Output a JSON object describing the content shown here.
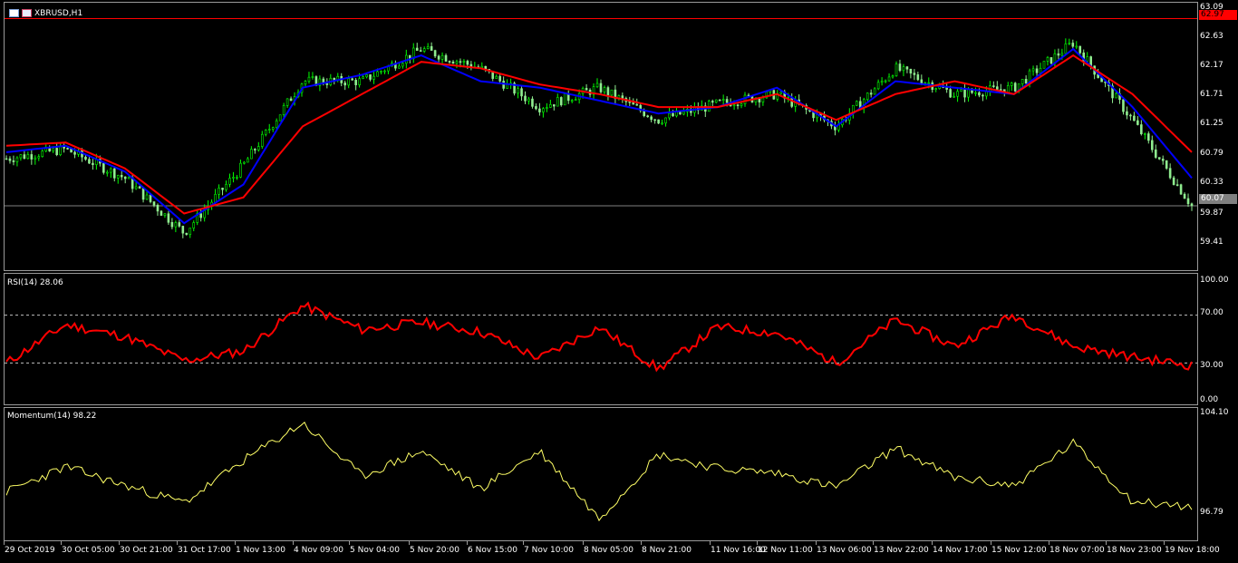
{
  "symbol_title": "XBRUSD,H1",
  "colors": {
    "background": "#000000",
    "bull_candle": "#00ff00",
    "candle": "#90ee90",
    "ma_fast": "#0000ff",
    "ma_slow": "#ff0000",
    "rsi_line": "#ff0000",
    "momentum_line": "#ffff66",
    "level_line": "#ff0000",
    "bid_line": "#808080",
    "grid": "#9a9a9a"
  },
  "price_axis": {
    "labels": [
      "63.09",
      "62.63",
      "62.17",
      "61.71",
      "61.25",
      "60.79",
      "60.33",
      "59.87",
      "59.41"
    ],
    "upper_tag": "62.97",
    "current_tag": "60.07"
  },
  "rsi": {
    "title": "RSI(14) 28.06",
    "axis_labels": [
      "100.00",
      "70.00",
      "30.00",
      "0.00"
    ],
    "levels": [
      70,
      30
    ]
  },
  "momentum": {
    "title": "Momentum(14) 98.22",
    "axis_labels": [
      "104.10",
      "96.79"
    ]
  },
  "time_axis": [
    "29 Oct 2019",
    "30 Oct 05:00",
    "30 Oct 21:00",
    "31 Oct 17:00",
    "1 Nov 13:00",
    "4 Nov 09:00",
    "5 Nov 04:00",
    "5 Nov 20:00",
    "6 Nov 15:00",
    "7 Nov 10:00",
    "8 Nov 05:00",
    "8 Nov 21:00",
    "11 Nov 16:00",
    "12 Nov 11:00",
    "13 Nov 06:00",
    "13 Nov 22:00",
    "14 Nov 17:00",
    "15 Nov 12:00",
    "18 Nov 07:00",
    "18 Nov 23:00",
    "19 Nov 18:00"
  ],
  "chart_data": [
    {
      "type": "line",
      "title": "XBRUSD,H1",
      "ylim": [
        59.1,
        63.09
      ],
      "x": [
        "29 Oct 2019",
        "30 Oct 05:00",
        "30 Oct 21:00",
        "31 Oct 17:00",
        "1 Nov 13:00",
        "4 Nov 09:00",
        "5 Nov 04:00",
        "5 Nov 20:00",
        "6 Nov 15:00",
        "7 Nov 10:00",
        "8 Nov 05:00",
        "8 Nov 21:00",
        "11 Nov 16:00",
        "12 Nov 11:00",
        "13 Nov 06:00",
        "13 Nov 22:00",
        "14 Nov 17:00",
        "15 Nov 12:00",
        "18 Nov 07:00",
        "18 Nov 23:00",
        "19 Nov 18:00"
      ],
      "series": [
        {
          "values": [
            60.8,
            60.95,
            60.5,
            59.65,
            60.7,
            62.0,
            62.0,
            62.5,
            62.2,
            61.6,
            61.9,
            61.4,
            61.65,
            61.8,
            61.3,
            62.2,
            61.8,
            61.9,
            62.6,
            61.4,
            60.07
          ]
        },
        {
          "values": [
            60.9,
            61.0,
            60.6,
            59.8,
            60.4,
            61.9,
            62.1,
            62.4,
            62.0,
            61.9,
            61.7,
            61.5,
            61.6,
            61.9,
            61.3,
            62.0,
            61.9,
            61.8,
            62.5,
            61.6,
            60.5
          ]
        },
        {
          "values": [
            61.0,
            61.05,
            60.65,
            59.95,
            60.2,
            61.3,
            61.8,
            62.3,
            62.2,
            61.95,
            61.8,
            61.6,
            61.6,
            61.8,
            61.4,
            61.8,
            62.0,
            61.8,
            62.4,
            61.8,
            60.9
          ]
        }
      ]
    },
    {
      "type": "line",
      "title": "RSI(14) 28.06",
      "ylim": [
        0,
        100
      ],
      "x": [
        "29 Oct 2019",
        "30 Oct 05:00",
        "30 Oct 21:00",
        "31 Oct 17:00",
        "1 Nov 13:00",
        "4 Nov 09:00",
        "5 Nov 04:00",
        "5 Nov 20:00",
        "6 Nov 15:00",
        "7 Nov 10:00",
        "8 Nov 05:00",
        "8 Nov 21:00",
        "11 Nov 16:00",
        "12 Nov 11:00",
        "13 Nov 06:00",
        "13 Nov 22:00",
        "14 Nov 17:00",
        "15 Nov 12:00",
        "18 Nov 07:00",
        "18 Nov 23:00",
        "19 Nov 18:00"
      ],
      "series": [
        {
          "values": [
            30,
            62,
            52,
            32,
            40,
            78,
            58,
            64,
            56,
            34,
            60,
            25,
            60,
            55,
            30,
            66,
            44,
            70,
            44,
            35,
            28.06
          ]
        }
      ]
    },
    {
      "type": "line",
      "title": "Momentum(14) 98.22",
      "ylim": [
        96.79,
        104.1
      ],
      "x": [
        "29 Oct 2019",
        "30 Oct 05:00",
        "30 Oct 21:00",
        "31 Oct 17:00",
        "1 Nov 13:00",
        "4 Nov 09:00",
        "5 Nov 04:00",
        "5 Nov 20:00",
        "6 Nov 15:00",
        "7 Nov 10:00",
        "8 Nov 05:00",
        "8 Nov 21:00",
        "11 Nov 16:00",
        "12 Nov 11:00",
        "13 Nov 06:00",
        "13 Nov 22:00",
        "14 Nov 17:00",
        "15 Nov 12:00",
        "18 Nov 07:00",
        "18 Nov 23:00",
        "19 Nov 18:00"
      ],
      "series": [
        {
          "values": [
            99.2,
            100.8,
            99.6,
            98.5,
            101.2,
            103.6,
            100.2,
            101.8,
            99.4,
            101.8,
            97.5,
            101.6,
            100.7,
            100.4,
            99.5,
            102.0,
            100.1,
            99.6,
            102.3,
            98.6,
            98.22
          ]
        }
      ]
    }
  ]
}
